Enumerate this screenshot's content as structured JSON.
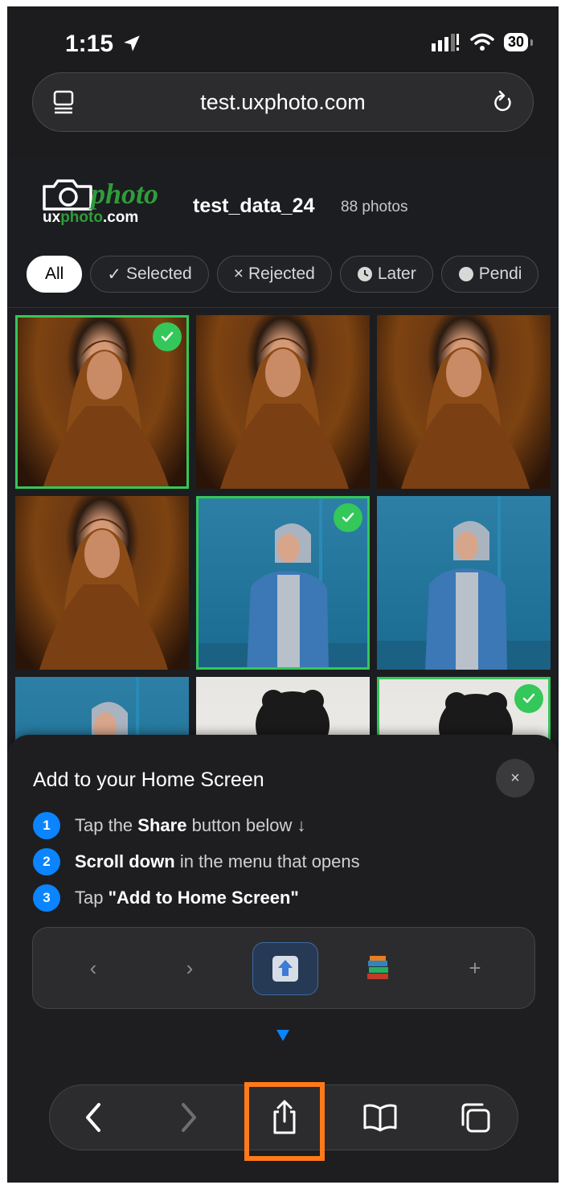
{
  "status_bar": {
    "time": "1:15",
    "battery": "30"
  },
  "browser": {
    "url": "test.uxphoto.com"
  },
  "header": {
    "logo_word": "photo",
    "logo_url_prefix": "ux",
    "logo_url_mid": "photo",
    "logo_url_suffix": ".com",
    "album_title": "test_data_24",
    "photo_count": "88 photos"
  },
  "filters": [
    {
      "label": "All",
      "icon": ""
    },
    {
      "label": "Selected",
      "icon": "✓"
    },
    {
      "label": "Rejected",
      "icon": "×"
    },
    {
      "label": "Later",
      "icon": "clock-icon"
    },
    {
      "label": "Pendi",
      "icon": "dot-icon"
    }
  ],
  "photos": [
    {
      "subject": "woman-brown-scarf",
      "selected": true
    },
    {
      "subject": "woman-brown-scarf",
      "selected": false
    },
    {
      "subject": "woman-brown-scarf",
      "selected": false
    },
    {
      "subject": "woman-brown-scarf",
      "selected": false
    },
    {
      "subject": "woman-denim-jacket",
      "selected": true
    },
    {
      "subject": "woman-denim-jacket",
      "selected": false
    },
    {
      "subject": "woman-denim-jacket",
      "selected": false
    },
    {
      "subject": "curly-hair",
      "selected": false
    },
    {
      "subject": "curly-hair",
      "selected": true
    }
  ],
  "sheet": {
    "title": "Add to your Home Screen",
    "close": "×",
    "step1_num": "1",
    "step1_pre": "Tap the",
    "step1_bold": "Share",
    "step1_post": "button below ↓",
    "step2_num": "2",
    "step2_bold": "Scroll down",
    "step2_post": "in the menu that opens",
    "step3_num": "3",
    "step3_pre": "Tap",
    "step3_bold": "\"Add to Home Screen\"",
    "demo_back": "‹",
    "demo_forward": "›",
    "demo_plus": "+"
  },
  "colors": {
    "accent": "#0a84ff",
    "selected": "#34c759",
    "highlight": "#ff7a1a"
  }
}
